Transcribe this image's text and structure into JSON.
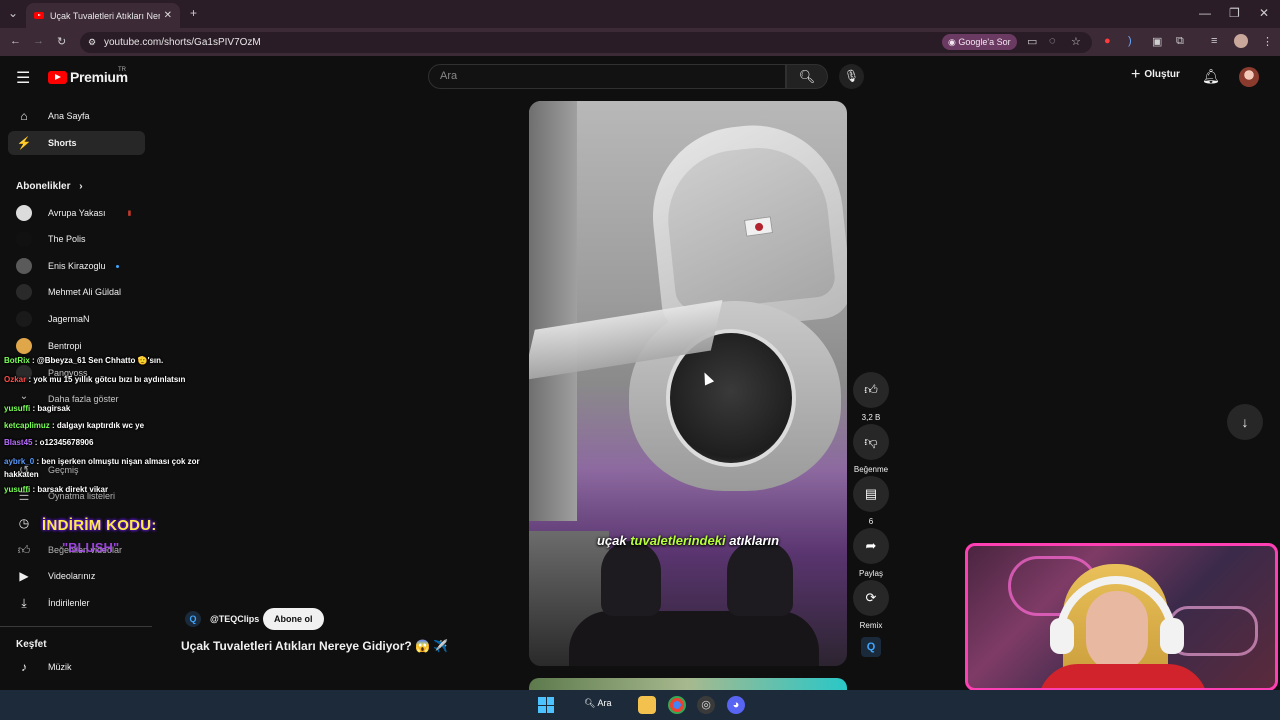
{
  "browser": {
    "tab_title": "Uçak Tuvaletleri Atıkları Nereye",
    "url": "youtube.com/shorts/Ga1sPIV7OzM",
    "google_sor": "Google'a Sor"
  },
  "header": {
    "logo_text": "Premium",
    "logo_region": "TR",
    "search_placeholder": "Ara",
    "create_label": "Oluştur"
  },
  "sidebar": {
    "items": [
      {
        "label": "Ana Sayfa",
        "icon": "home-icon"
      },
      {
        "label": "Shorts",
        "icon": "shorts-icon",
        "active": true
      }
    ],
    "subscriptions_title": "Abonelikler",
    "subscriptions": [
      {
        "label": "Avrupa Yakası",
        "color": "#dcdcdc"
      },
      {
        "label": "The Polis",
        "color": "#111111"
      },
      {
        "label": "Enis Kirazoglu",
        "color": "#5a5a5a"
      },
      {
        "label": "Mehmet Ali Güldal",
        "color": "#2a2a2a"
      },
      {
        "label": "JagermaN",
        "color": "#1a1a1a"
      },
      {
        "label": "Bentropi",
        "color": "#e0a64a"
      },
      {
        "label": "Pangyoss",
        "color": "#333333"
      }
    ],
    "show_more": "Daha fazla göster",
    "you_items": [
      {
        "label": "Geçmiş",
        "icon": "history-icon"
      },
      {
        "label": "Oynatma listeleri",
        "icon": "playlist-icon"
      },
      {
        "label": "Sonra izle",
        "icon": "clock-icon"
      },
      {
        "label": "Beğenilen videolar",
        "icon": "like-icon"
      },
      {
        "label": "Videolarınız",
        "icon": "video-icon"
      },
      {
        "label": "İndirilenler",
        "icon": "download-icon"
      }
    ],
    "explore_title": "Keşfet",
    "explore_items": [
      {
        "label": "Müzik",
        "icon": "music-icon"
      }
    ]
  },
  "chat": [
    {
      "user": "BotRix",
      "user_color": "#7dff5a",
      "text": ": @Bbeyza_61 Sen Chhatto 🫡'sın."
    },
    {
      "user": "Ozkar",
      "user_color": "#ff4d4d",
      "text": ": yok mu 15 yıllık götcu bızı bı aydınlatsın"
    },
    {
      "user": "yusuffi",
      "user_color": "#7dff5a",
      "text": ": bagirsak"
    },
    {
      "user": "ketcaplimuz",
      "user_color": "#7dff5a",
      "text": ": dalgayı kaptırdık wc ye"
    },
    {
      "user": "Blast45",
      "user_color": "#b96cff",
      "text": ": o12345678906"
    },
    {
      "user": "aybrk_0",
      "user_color": "#5a9bff",
      "text": ": ben işerken olmuştu nişan alması çok zor hakkaten"
    },
    {
      "user": "yusuffi",
      "user_color": "#7dff5a",
      "text": ": barsak direkt vikar"
    }
  ],
  "promo": {
    "line1": "İNDİRİM KODU:",
    "line2": "\"BLUSH\""
  },
  "short": {
    "caption_pre": "uçak",
    "caption_hl": "tuvaletlerindeki",
    "caption_post": "atıkların",
    "channel": "@TEQClips",
    "subscribe_label": "Abone ol",
    "title": "Uçak Tuvaletleri Atıkları Nereye Gidiyor? 😱 ✈️"
  },
  "actions": {
    "like_count": "3,2 B",
    "dislike_label": "Beğenme",
    "comment_count": "6",
    "share_label": "Paylaş",
    "remix_label": "Remix"
  },
  "taskbar": {
    "search_label": "Ara"
  }
}
